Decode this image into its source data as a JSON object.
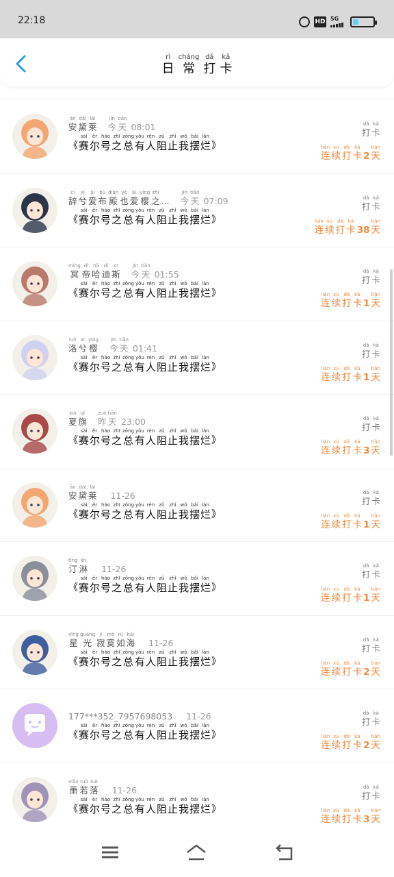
{
  "status": {
    "time": "22:18",
    "hd_label": "HD",
    "network_label": "5G"
  },
  "header": {
    "title_chars": [
      "日",
      "常",
      "打",
      "卡"
    ],
    "title_pinyin": [
      "rì",
      "cháng",
      "dǎ",
      "kǎ"
    ]
  },
  "message_template": {
    "chars": [
      "赛",
      "尔",
      "号",
      "之",
      "总",
      "有",
      "人",
      "阻",
      "止",
      "我",
      "摆",
      "烂"
    ],
    "pinyin": [
      "sài",
      "ěr",
      "hào",
      "zhī",
      "zǒng",
      "yǒu",
      "rén",
      "zǔ",
      "zhǐ",
      "wǒ",
      "bǎi",
      "làn"
    ],
    "open_bracket": "《",
    "close_bracket": "》"
  },
  "daka_label": {
    "chars": [
      "打",
      "卡"
    ],
    "pinyin": [
      "dǎ",
      "kǎ"
    ]
  },
  "streak_label": {
    "prefix_chars": [
      "连",
      "续",
      "打",
      "卡"
    ],
    "prefix_pinyin": [
      "lián",
      "xù",
      "dǎ",
      "kǎ"
    ],
    "suffix_char": "天",
    "suffix_pinyin": "tiān"
  },
  "rows": [
    {
      "name_chars": [
        "安",
        "黛",
        "莱"
      ],
      "name_pinyin": [
        "ān",
        "dài",
        "lái"
      ],
      "time_chars": [
        "今",
        "天"
      ],
      "time_pinyin": [
        "jīn",
        "tiān"
      ],
      "time_value": "08:01",
      "streak_days": "2",
      "avatar_color": "#f4a672"
    },
    {
      "name_chars": [
        "辞",
        "兮",
        "爱",
        "布",
        "殿",
        "也",
        "爱",
        "樱",
        "之",
        "..."
      ],
      "name_pinyin": [
        "cí",
        "xī",
        "ài",
        "bù",
        "diàn",
        "yě",
        "ài",
        "yīng",
        "zhī",
        ""
      ],
      "time_chars": [
        "今",
        "天"
      ],
      "time_pinyin": [
        "jīn",
        "tiān"
      ],
      "time_value": "07:09",
      "streak_days": "38",
      "avatar_color": "#2b3548"
    },
    {
      "name_chars": [
        "冥",
        "帝",
        "哈",
        "迪",
        "斯"
      ],
      "name_pinyin": [
        "míng",
        "dì",
        "hā",
        "dí",
        "sī"
      ],
      "time_chars": [
        "今",
        "天"
      ],
      "time_pinyin": [
        "jīn",
        "tiān"
      ],
      "time_value": "01:55",
      "streak_days": "1",
      "avatar_color": "#b87a6a"
    },
    {
      "name_chars": [
        "洛",
        "兮",
        "樱"
      ],
      "name_pinyin": [
        "luò",
        "xī",
        "yīng"
      ],
      "time_chars": [
        "今",
        "天"
      ],
      "time_pinyin": [
        "jīn",
        "tiān"
      ],
      "time_value": "01:41",
      "streak_days": "1",
      "avatar_color": "#cfd2ee"
    },
    {
      "name_chars": [
        "夏",
        "旗"
      ],
      "name_pinyin": [
        "xià",
        "qí"
      ],
      "time_chars": [
        "昨",
        "天"
      ],
      "time_pinyin": [
        "zuó",
        "tiān"
      ],
      "time_value": "23:00",
      "streak_days": "3",
      "avatar_color": "#a84a48"
    },
    {
      "name_chars": [
        "安",
        "黛",
        "莱"
      ],
      "name_pinyin": [
        "ān",
        "dài",
        "lái"
      ],
      "time_chars": [],
      "time_pinyin": [],
      "time_value": "11-26",
      "streak_days": "1",
      "avatar_color": "#f4a672"
    },
    {
      "name_chars": [
        "汀",
        "淋"
      ],
      "name_pinyin": [
        "tīng",
        "lín"
      ],
      "time_chars": [],
      "time_pinyin": [],
      "time_value": "11-26",
      "streak_days": "1",
      "avatar_color": "#8a8f9a"
    },
    {
      "name_chars": [
        "星",
        "光",
        "寂",
        "寞",
        "如",
        "海"
      ],
      "name_pinyin": [
        "xīng",
        "guāng",
        "jì",
        "mò",
        "rú",
        "hǎi"
      ],
      "time_chars": [],
      "time_pinyin": [],
      "time_value": "11-26",
      "streak_days": "2",
      "avatar_color": "#3e5f9e"
    },
    {
      "name_plain": "177***352_7957698053",
      "time_chars": [],
      "time_pinyin": [],
      "time_value": "11-26",
      "streak_days": "2",
      "avatar_color": "#d7bef2",
      "avatar_kind": "chat-bubble"
    },
    {
      "name_chars": [
        "萧",
        "若",
        "落"
      ],
      "name_pinyin": [
        "xiāo",
        "ruò",
        "luò"
      ],
      "time_chars": [],
      "time_pinyin": [],
      "time_value": "11-26",
      "streak_days": "3",
      "avatar_color": "#9f93b8"
    }
  ]
}
